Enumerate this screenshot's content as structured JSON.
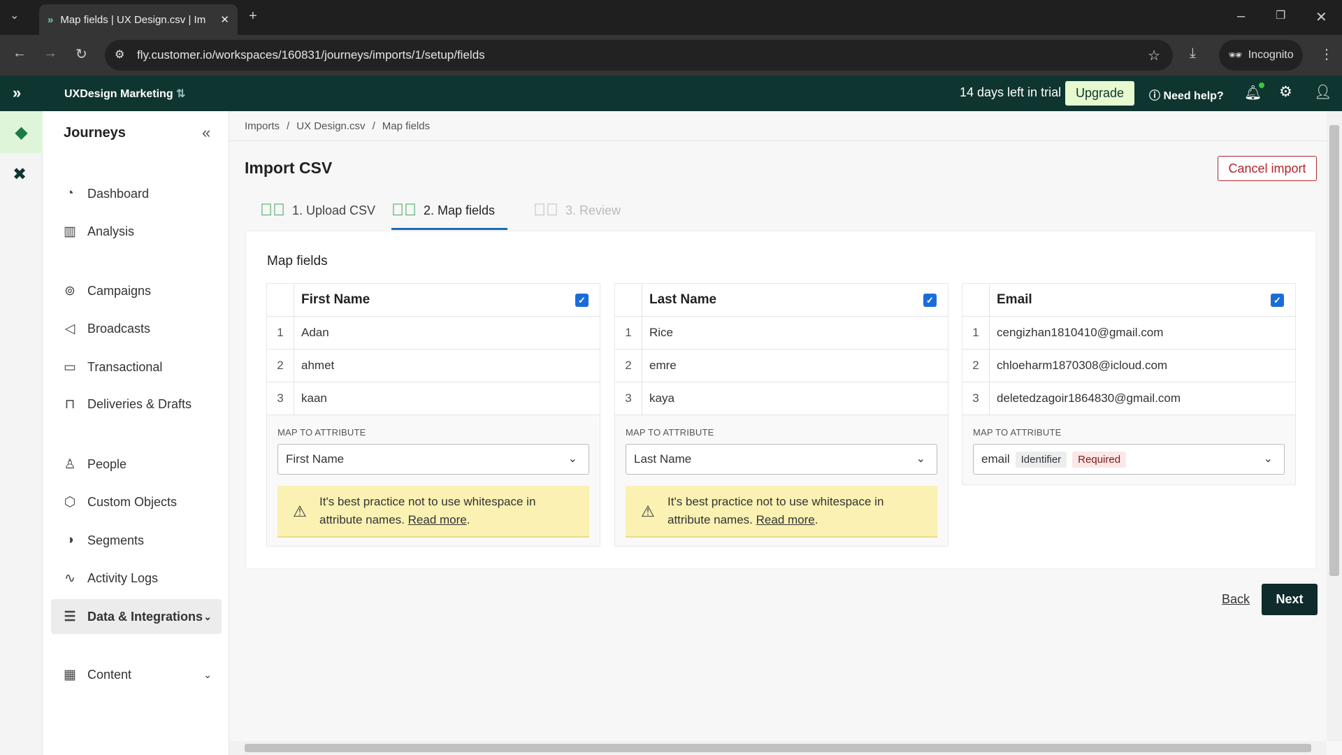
{
  "browser": {
    "tab_title": "Map fields | UX Design.csv | Im",
    "url": "fly.customer.io/workspaces/160831/journeys/imports/1/setup/fields",
    "incognito": "Incognito"
  },
  "header": {
    "workspace": "UXDesign Marketing",
    "trial": "14 days left in trial",
    "upgrade": "Upgrade",
    "help": "Need help?"
  },
  "sidebar": {
    "title": "Journeys",
    "items": [
      {
        "label": "Dashboard",
        "icon": "dashboard-icon"
      },
      {
        "label": "Analysis",
        "icon": "bar-chart-icon"
      },
      {
        "label": "Campaigns",
        "icon": "campaigns-icon"
      },
      {
        "label": "Broadcasts",
        "icon": "megaphone-icon"
      },
      {
        "label": "Transactional",
        "icon": "terminal-icon"
      },
      {
        "label": "Deliveries & Drafts",
        "icon": "inbox-icon"
      },
      {
        "label": "People",
        "icon": "person-icon"
      },
      {
        "label": "Custom Objects",
        "icon": "cube-icon"
      },
      {
        "label": "Segments",
        "icon": "segments-icon"
      },
      {
        "label": "Activity Logs",
        "icon": "activity-icon"
      },
      {
        "label": "Data & Integrations",
        "icon": "database-icon"
      },
      {
        "label": "Content",
        "icon": "table-icon"
      }
    ]
  },
  "breadcrumb": [
    "Imports",
    "UX Design.csv",
    "Map fields"
  ],
  "page": {
    "title": "Import CSV",
    "cancel": "Cancel import",
    "steps": [
      "1. Upload CSV",
      "2. Map fields",
      "3. Review"
    ],
    "section": "Map fields",
    "back": "Back",
    "next": "Next"
  },
  "columns": [
    {
      "header": "First Name",
      "rows": [
        "Adan",
        "ahmet",
        "kaan"
      ],
      "map_label": "MAP TO ATTRIBUTE",
      "attribute": "First Name",
      "warning": "It's best practice not to use whitespace in attribute names.",
      "read_more": "Read more"
    },
    {
      "header": "Last Name",
      "rows": [
        "Rice",
        "emre",
        "kaya"
      ],
      "map_label": "MAP TO ATTRIBUTE",
      "attribute": "Last Name",
      "warning": "It's best practice not to use whitespace in attribute names.",
      "read_more": "Read more"
    },
    {
      "header": "Email",
      "rows": [
        "cengizhan1810410@gmail.com",
        "chloeharm1870308@icloud.com",
        "deletedzagoir1864830@gmail.com"
      ],
      "map_label": "MAP TO ATTRIBUTE",
      "attribute": "email",
      "badges": [
        "Identifier",
        "Required"
      ]
    }
  ],
  "row_numbers": [
    "1",
    "2",
    "3"
  ],
  "colors": {
    "header_bg": "#0f3530",
    "upgrade_bg": "#e6f9cf",
    "accent": "#1a6dd9",
    "cancel": "#b3262c",
    "check": "#2a9d4a"
  }
}
